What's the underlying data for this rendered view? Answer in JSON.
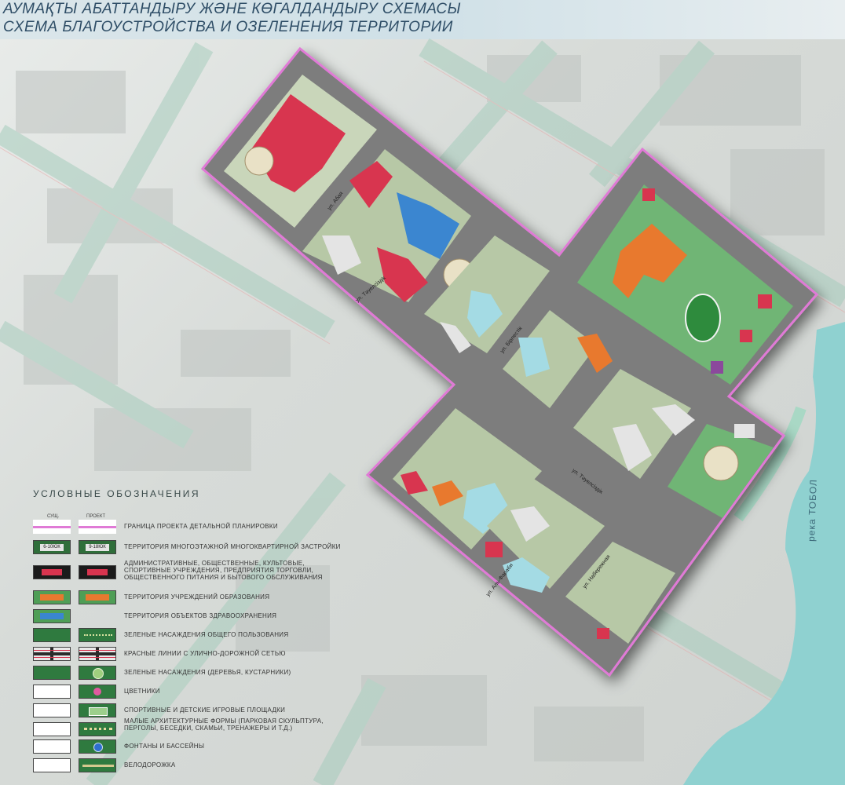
{
  "header": {
    "title_kz": "АУМАҚТЫ АБАТТАНДЫРУ ЖӘНЕ КӨГАЛДАНДЫРУ СХЕМАСЫ",
    "title_ru": "СХЕМА БЛАГОУСТРОЙСТВА И ОЗЕЛЕНЕНИЯ ТЕРРИТОРИИ"
  },
  "map": {
    "streets": [
      "ул. Абая",
      "ул. Тәуелсіздік",
      "ул. Бірлестік",
      "ул. Тәуелсіздік",
      "ул. Набережная",
      "ул. Аль-Фараби"
    ],
    "river_label": "река ТОБОЛ",
    "colors": {
      "boundary": "#e07ad6",
      "roads": "#7d7d7d",
      "admin": "#d8344f",
      "education": "#e8792f",
      "healthcare": "#3a86d0",
      "greenery": "#4f9e56",
      "residential": "#e4e4e4",
      "water": "#8fd1d0"
    }
  },
  "legend": {
    "title": "УСЛОВНЫЕ ОБОЗНАЧЕНИЯ",
    "col_existing": "СУЩ.",
    "col_project": "ПРОЕКТ",
    "items": [
      {
        "label": "ГРАНИЦА ПРОЕКТА ДЕТАЛЬНОЙ ПЛАНИРОВКИ"
      },
      {
        "label": "ТЕРРИТОРИЯ МНОГОЭТАЖНОЙ МНОГОКВАРТИРНОЙ ЗАСТРОЙКИ",
        "code_existing": "6-10ЮК",
        "code_project": "9-18ЮК"
      },
      {
        "label": "АДМИНИСТРАТИВНЫЕ, ОБЩЕСТВЕННЫЕ, КУЛЬТОВЫЕ, СПОРТИВНЫЕ УЧРЕЖДЕНИЯ, ПРЕДПРИЯТИЯ ТОРГОВЛИ, ОБЩЕСТВЕННОГО ПИТАНИЯ И БЫТОВОГО ОБСЛУЖИВАНИЯ"
      },
      {
        "label": "ТЕРРИТОРИЯ УЧРЕЖДЕНИЙ ОБРАЗОВАНИЯ"
      },
      {
        "label": "ТЕРРИТОРИЯ ОБЪЕКТОВ ЗДРАВООХРАНЕНИЯ"
      },
      {
        "label": "ЗЕЛЕНЫЕ НАСАЖДЕНИЯ ОБЩЕГО ПОЛЬЗОВАНИЯ"
      },
      {
        "label": "КРАСНЫЕ ЛИНИИ С УЛИЧНО-ДОРОЖНОЙ СЕТЬЮ"
      },
      {
        "label": "ЗЕЛЕНЫЕ НАСАЖДЕНИЯ (ДЕРЕВЬЯ, КУСТАРНИКИ)"
      },
      {
        "label": "ЦВЕТНИКИ"
      },
      {
        "label": "СПОРТИВНЫЕ И ДЕТСКИЕ ИГРОВЫЕ ПЛОЩАДКИ"
      },
      {
        "label": "МАЛЫЕ АРХИТЕКТУРНЫЕ ФОРМЫ (ПАРКОВАЯ СКУЛЬПТУРА, ПЕРГОЛЫ, БЕСЕДКИ, СКАМЬИ, ТРЕНАЖЕРЫ И Т.Д.)"
      },
      {
        "label": "ФОНТАНЫ И БАССЕЙНЫ"
      },
      {
        "label": "ВЕЛОДОРОЖКА"
      }
    ]
  }
}
